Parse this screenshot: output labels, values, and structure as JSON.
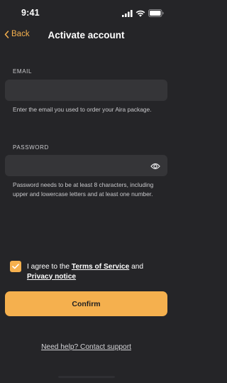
{
  "status_bar": {
    "time": "9:41"
  },
  "nav": {
    "back_label": "Back",
    "title": "Activate account"
  },
  "email": {
    "label": "EMAIL",
    "value": "",
    "help": "Enter the email you used to order your Aira package."
  },
  "password": {
    "label": "PASSWORD",
    "value": "",
    "help": "Password needs to be at least 8 characters, including upper and lowercase letters and at least one number."
  },
  "agreement": {
    "checked": true,
    "prefix": "I agree to the",
    "terms_link": "Terms of Service",
    "conjunction": "and",
    "privacy_link": "Privacy notice"
  },
  "confirm_label": "Confirm",
  "support_link": "Need help? Contact support",
  "colors": {
    "background": "#252528",
    "field": "#353538",
    "accent": "#f5b04e",
    "muted_text": "#c9c9cc"
  },
  "icons": {
    "back": "chevron-left-icon",
    "password_toggle": "eye-icon",
    "checkbox": "checkmark-icon",
    "signal": "signal-icon",
    "wifi": "wifi-icon",
    "battery": "battery-icon"
  }
}
